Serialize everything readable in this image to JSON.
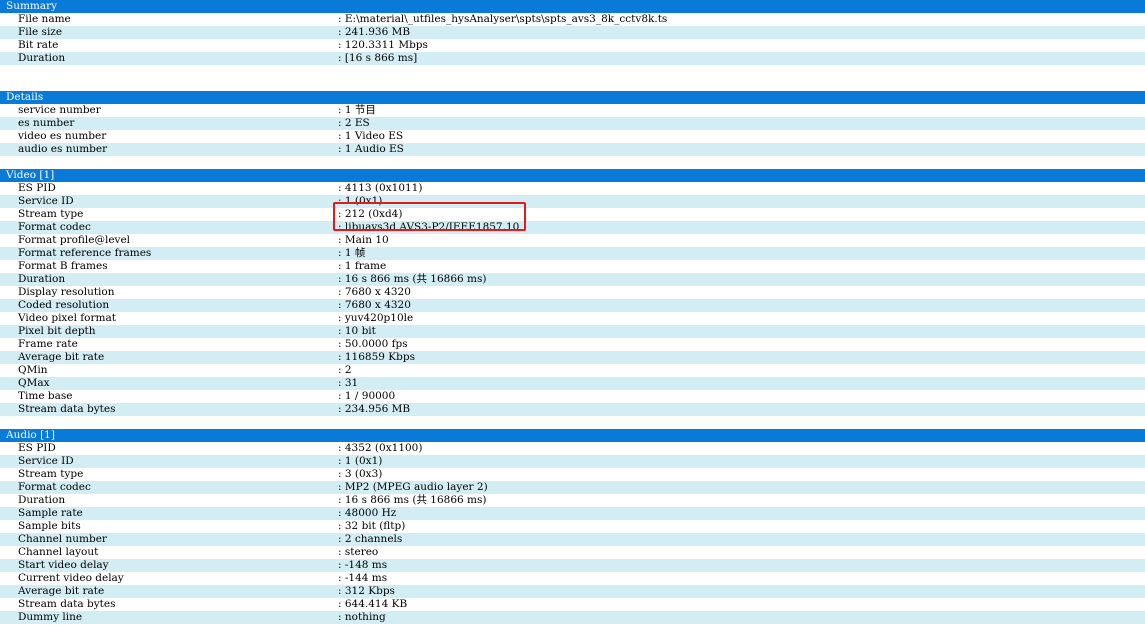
{
  "sections": [
    {
      "title": "Summary",
      "rows": [
        {
          "key": "File name",
          "value": ": E:\\material\\_utfiles_hysAnalyser\\spts\\spts_avs3_8k_cctv8k.ts"
        },
        {
          "key": "File size",
          "value": ": 241.936 MB"
        },
        {
          "key": "Bit rate",
          "value": ": 120.3311 Mbps"
        },
        {
          "key": "Duration",
          "value": ": [16 s 866 ms]"
        }
      ]
    },
    {
      "title": "Details",
      "rows": [
        {
          "key": "service number",
          "value": ": 1 节目"
        },
        {
          "key": "es number",
          "value": ": 2 ES"
        },
        {
          "key": "video es number",
          "value": ": 1 Video ES"
        },
        {
          "key": "audio es number",
          "value": ": 1 Audio ES"
        }
      ]
    },
    {
      "title": "Video [1]",
      "rows": [
        {
          "key": "ES PID",
          "value": ": 4113 (0x1011)"
        },
        {
          "key": "Service ID",
          "value": ": 1 (0x1)"
        },
        {
          "key": "Stream type",
          "value": ": 212 (0xd4)"
        },
        {
          "key": "Format codec",
          "value": ": libuavs3d AVS3-P2/IEEE1857.10"
        },
        {
          "key": "Format profile@level",
          "value": ": Main 10"
        },
        {
          "key": "Format reference frames",
          "value": ": 1 帧"
        },
        {
          "key": "Format B frames",
          "value": ": 1 frame"
        },
        {
          "key": "Duration",
          "value": ": 16 s 866 ms (共 16866 ms)"
        },
        {
          "key": "Display resolution",
          "value": ": 7680 x 4320"
        },
        {
          "key": "Coded resolution",
          "value": ": 7680 x 4320"
        },
        {
          "key": "Video pixel format",
          "value": ": yuv420p10le"
        },
        {
          "key": "Pixel bit depth",
          "value": ": 10 bit"
        },
        {
          "key": "Frame rate",
          "value": ": 50.0000 fps"
        },
        {
          "key": "Average bit rate",
          "value": ": 116859 Kbps"
        },
        {
          "key": "QMin",
          "value": ": 2"
        },
        {
          "key": "QMax",
          "value": ": 31"
        },
        {
          "key": "Time base",
          "value": ": 1 / 90000"
        },
        {
          "key": "Stream data bytes",
          "value": ": 234.956 MB"
        }
      ]
    },
    {
      "title": "Audio [1]",
      "rows": [
        {
          "key": "ES PID",
          "value": ": 4352 (0x1100)"
        },
        {
          "key": "Service ID",
          "value": ": 1 (0x1)"
        },
        {
          "key": "Stream type",
          "value": ": 3 (0x3)"
        },
        {
          "key": "Format codec",
          "value": ": MP2 (MPEG audio layer 2)"
        },
        {
          "key": "Duration",
          "value": ": 16 s 866 ms (共 16866 ms)"
        },
        {
          "key": "Sample rate",
          "value": ": 48000 Hz"
        },
        {
          "key": "Sample bits",
          "value": ": 32 bit (fltp)"
        },
        {
          "key": "Channel number",
          "value": ": 2 channels"
        },
        {
          "key": "Channel layout",
          "value": ": stereo"
        },
        {
          "key": "Start video delay",
          "value": ": -148 ms"
        },
        {
          "key": "Current video delay",
          "value": ": -144 ms"
        },
        {
          "key": "Average bit rate",
          "value": ": 312 Kbps"
        },
        {
          "key": "Stream data bytes",
          "value": ": 644.414 KB"
        },
        {
          "key": "Dummy line",
          "value": ": nothing"
        }
      ]
    }
  ],
  "colors": {
    "header_bg": "#0a7ad8",
    "row_alt_bg": "#d3edf4",
    "highlight_border": "#e01b1b"
  }
}
